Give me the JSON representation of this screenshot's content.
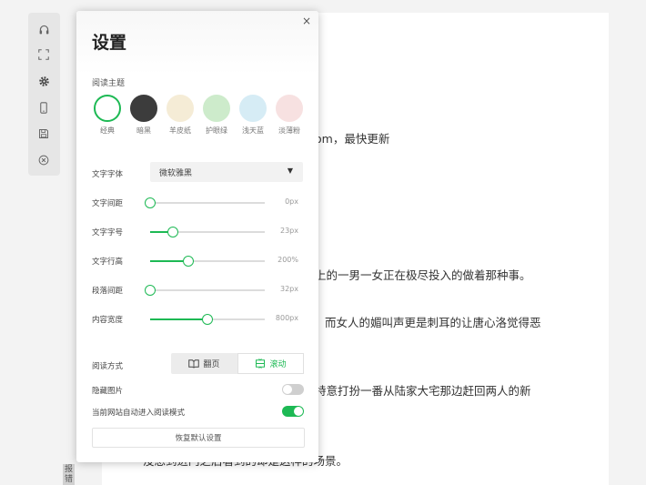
{
  "toolbar": {
    "icons": [
      "headphones-icon",
      "fullscreen-icon",
      "gear-icon",
      "phone-icon",
      "save-icon",
      "close-circle-icon"
    ]
  },
  "reader": {
    "lines": [
      "om，最快更新",
      "上的一男一女正在极尽投入的做着那种事。",
      "而女人的媚叫声更是刺耳的让唐心洛觉得恶",
      "特意打扮一番从陆家大宅那边赶回两人的新",
      "没想到进门之后看到的却是这样的场景。"
    ],
    "side_tag": "报\n错"
  },
  "settings": {
    "title": "设置",
    "close": "×",
    "theme_label": "阅读主题",
    "themes": [
      {
        "name": "经典",
        "color": "#ffffff",
        "selected": true
      },
      {
        "name": "暗黑",
        "color": "#3c3c3c",
        "selected": false
      },
      {
        "name": "羊皮纸",
        "color": "#f5ecd6",
        "selected": false
      },
      {
        "name": "护眼绿",
        "color": "#cdebcb",
        "selected": false
      },
      {
        "name": "浅天蓝",
        "color": "#d6ecf5",
        "selected": false
      },
      {
        "name": "淡薄粉",
        "color": "#f7e1e1",
        "selected": false
      }
    ],
    "font_label": "文字字体",
    "font_value": "微软雅黑",
    "font_arrow": "▼",
    "sliders": [
      {
        "label": "文字间距",
        "value": "0px",
        "fraction": 0.0
      },
      {
        "label": "文字字号",
        "value": "23px",
        "fraction": 0.2
      },
      {
        "label": "文字行高",
        "value": "200%",
        "fraction": 0.33
      },
      {
        "label": "段落间距",
        "value": "32px",
        "fraction": 0.0
      },
      {
        "label": "内容宽度",
        "value": "800px",
        "fraction": 0.5
      }
    ],
    "mode_label": "阅读方式",
    "mode_options": [
      {
        "label": "翻页",
        "icon": "book-icon",
        "active": false
      },
      {
        "label": "滚动",
        "icon": "scroll-icon",
        "active": true
      }
    ],
    "hide_images_label": "隐藏图片",
    "hide_images_on": false,
    "auto_read_label": "当前网站自动进入阅读模式",
    "auto_read_on": true,
    "reset_label": "恢复默认设置",
    "accent": "#1db954"
  }
}
